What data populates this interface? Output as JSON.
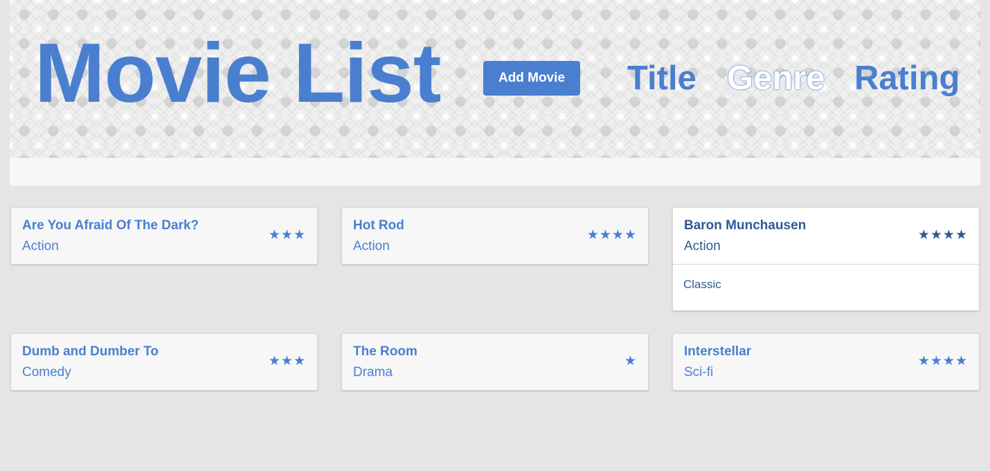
{
  "header": {
    "title": "Movie List",
    "add_button_label": "Add Movie",
    "sort_options": {
      "title": "Title",
      "genre": "Genre",
      "rating": "Rating"
    }
  },
  "colors": {
    "accent": "#4a7fd0",
    "accent_dark": "#2f5a96",
    "background": "#e5e5e5"
  },
  "movies": [
    {
      "title": "Are You Afraid Of The Dark?",
      "genre": "Action",
      "rating": "★★★"
    },
    {
      "title": "Hot Rod",
      "genre": "Action",
      "rating": "★★★★"
    },
    {
      "title": "Baron Munchausen",
      "genre": "Action",
      "rating": "★★★★",
      "note": "Classic"
    },
    {
      "title": "Dumb and Dumber To",
      "genre": "Comedy",
      "rating": "★★★"
    },
    {
      "title": "The Room",
      "genre": "Drama",
      "rating": "★"
    },
    {
      "title": "Interstellar",
      "genre": "Sci-fi",
      "rating": "★★★★"
    }
  ]
}
